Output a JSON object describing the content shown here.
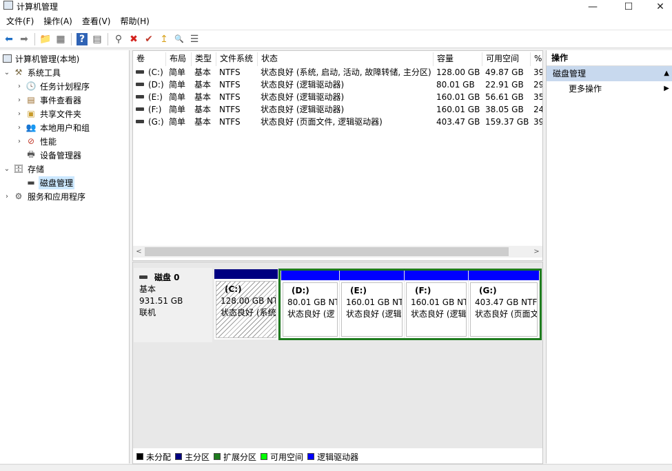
{
  "window": {
    "title": "计算机管理",
    "controls": {
      "minimize": "—",
      "maximize": "☐",
      "close": "✕"
    }
  },
  "menu": [
    "文件(F)",
    "操作(A)",
    "查看(V)",
    "帮助(H)"
  ],
  "toolbar": {
    "icons": [
      "back-icon",
      "forward-icon",
      "up-folder-icon",
      "show-hide-tree-icon",
      "help-icon",
      "properties-icon",
      "connect-icon",
      "delete-icon",
      "check-icon",
      "export-icon",
      "search-icon",
      "settings-icon"
    ],
    "glyphs": {
      "back": "⬅",
      "forward": "➡",
      "folder": "📁",
      "tree": "▦",
      "help": "?",
      "panel": "▤",
      "connect": "⚲",
      "delete": "✖",
      "check": "✔",
      "export": "↥",
      "search": "🔍",
      "props": "☰"
    }
  },
  "tree": {
    "root": "计算机管理(本地)",
    "system_tools": "系统工具",
    "task_scheduler": "任务计划程序",
    "event_viewer": "事件查看器",
    "shared_folders": "共享文件夹",
    "local_users": "本地用户和组",
    "performance": "性能",
    "device_manager": "设备管理器",
    "storage": "存储",
    "disk_management": "磁盘管理",
    "services_apps": "服务和应用程序"
  },
  "volumes": {
    "headers": [
      "卷",
      "布局",
      "类型",
      "文件系统",
      "状态",
      "容量",
      "可用空间",
      "%"
    ],
    "rows": [
      [
        "(C:)",
        "简单",
        "基本",
        "NTFS",
        "状态良好 (系统, 启动, 活动, 故障转储, 主分区)",
        "128.00 GB",
        "49.87 GB",
        "39"
      ],
      [
        "(D:)",
        "简单",
        "基本",
        "NTFS",
        "状态良好 (逻辑驱动器)",
        "80.01 GB",
        "22.91 GB",
        "29"
      ],
      [
        "(E:)",
        "简单",
        "基本",
        "NTFS",
        "状态良好 (逻辑驱动器)",
        "160.01 GB",
        "56.61 GB",
        "35"
      ],
      [
        "(F:)",
        "简单",
        "基本",
        "NTFS",
        "状态良好 (逻辑驱动器)",
        "160.01 GB",
        "38.05 GB",
        "24"
      ],
      [
        "(G:)",
        "简单",
        "基本",
        "NTFS",
        "状态良好 (页面文件, 逻辑驱动器)",
        "403.47 GB",
        "159.37 GB",
        "39"
      ]
    ],
    "scroll_left": "<",
    "scroll_right": ">"
  },
  "disk": {
    "name": "磁盘 0",
    "type": "基本",
    "size": "931.51 GB",
    "status": "联机",
    "partitions": [
      {
        "name": "(C:)",
        "size": "128.00 GB NT",
        "status": "状态良好 (系统"
      },
      {
        "name": "(D:)",
        "size": "80.01 GB NT",
        "status": "状态良好 (逻"
      },
      {
        "name": "(E:)",
        "size": "160.01 GB NT",
        "status": "状态良好 (逻辑"
      },
      {
        "name": "(F:)",
        "size": "160.01 GB NT",
        "status": "状态良好 (逻辑"
      },
      {
        "name": "(G:)",
        "size": "403.47 GB NTF",
        "status": "状态良好 (页面文"
      }
    ]
  },
  "legend": [
    {
      "label": "未分配",
      "color": "#000000"
    },
    {
      "label": "主分区",
      "color": "#000080"
    },
    {
      "label": "扩展分区",
      "color": "#1e7b1e"
    },
    {
      "label": "可用空间",
      "color": "#00ff00"
    },
    {
      "label": "逻辑驱动器",
      "color": "#0000ff"
    }
  ],
  "actions": {
    "header": "操作",
    "section": "磁盘管理",
    "more": "更多操作",
    "caret_up": "▲",
    "caret_right": "▶"
  },
  "colors": {
    "primary_partition": "#000080",
    "logical_drive": "#0000ff",
    "extended_partition": "#1e7b1e",
    "selection": "#cce8ff",
    "action_section": "#c8d9ee"
  }
}
